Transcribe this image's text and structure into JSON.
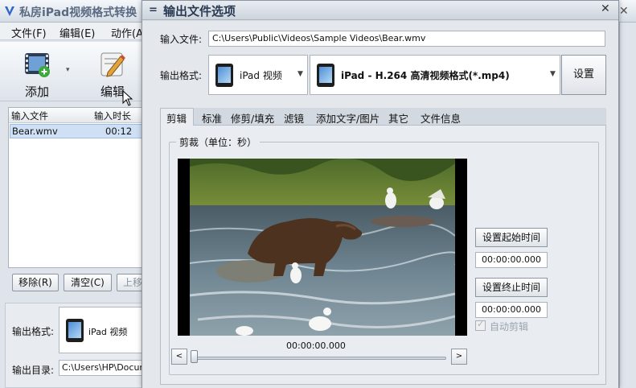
{
  "app": {
    "title": "私房iPad视频格式转换",
    "menu": [
      {
        "label": "文件(F)"
      },
      {
        "label": "编辑(E)"
      },
      {
        "label": "动作(A)"
      }
    ],
    "toolbar": {
      "add_label": "添加",
      "edit_label": "编辑"
    },
    "file_list": {
      "headers": [
        "输入文件",
        "输入时长"
      ],
      "rows": [
        {
          "name": "Bear.wmv",
          "duration": "00:12"
        }
      ]
    },
    "list_buttons": {
      "remove": "移除(R)",
      "clear": "清空(C)",
      "up": "上移"
    },
    "bottom": {
      "format_label": "输出格式:",
      "format_value": "iPad 视频",
      "dir_label": "输出目录:",
      "dir_value": "C:\\Users\\HP\\Documen"
    }
  },
  "dialog": {
    "title": "输出文件选项",
    "input_label": "输入文件:",
    "input_value": "C:\\Users\\Public\\Videos\\Sample Videos\\Bear.wmv",
    "format_label": "输出格式:",
    "device_value": "iPad 视频",
    "profile_value": "iPad - H.264 高清视频格式(*.mp4)",
    "settings_label": "设置",
    "tabs": [
      {
        "label": "剪辑"
      },
      {
        "label": "标准"
      },
      {
        "label": "修剪/填充"
      },
      {
        "label": "滤镜"
      },
      {
        "label": "添加文字/图片"
      },
      {
        "label": "其它"
      },
      {
        "label": "文件信息"
      }
    ],
    "active_tab": "剪辑",
    "trim": {
      "legend": "剪裁（单位：秒）",
      "current_time": "00:00:00.000",
      "prev_label": "<",
      "next_label": ">",
      "set_start_label": "设置起始时间",
      "start_value": "00:00:00.000",
      "set_end_label": "设置终止时间",
      "end_value": "00:00:00.000",
      "auto_trim_label": "自动剪辑",
      "auto_trim_checked": true,
      "auto_trim_enabled": false,
      "seek_position": 0
    }
  },
  "colors": {
    "accent": "#2a3a52",
    "selection": "#cfe0f4"
  }
}
